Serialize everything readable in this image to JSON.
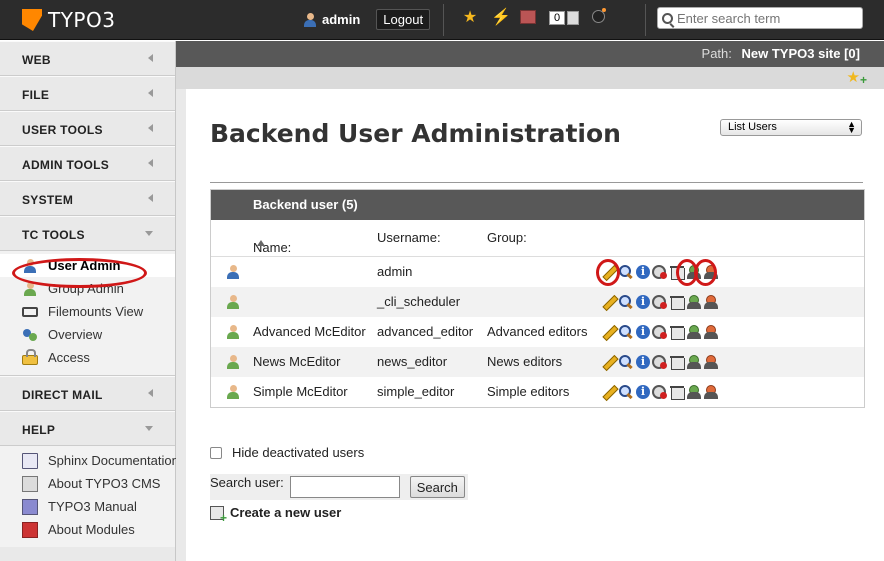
{
  "topbar": {
    "logo_text": "TYPO3",
    "username": "admin",
    "logout_label": "Logout",
    "workspace_counter": "0",
    "search_placeholder": "Enter search term",
    "icons": [
      "bookmark-star-icon",
      "clear-cache-bolt-icon",
      "cache-icon",
      "taskcenter-icon",
      "debug-bomb-icon"
    ]
  },
  "sidebar": {
    "groups": [
      {
        "label": "WEB"
      },
      {
        "label": "FILE"
      },
      {
        "label": "USER TOOLS"
      },
      {
        "label": "ADMIN TOOLS"
      },
      {
        "label": "SYSTEM"
      },
      {
        "label": "TC TOOLS"
      },
      {
        "label": "DIRECT MAIL"
      },
      {
        "label": "HELP"
      }
    ],
    "tc_tools_items": [
      {
        "label": "User Admin",
        "icon": "user-icon",
        "active": true
      },
      {
        "label": "Group Admin",
        "icon": "group-icon"
      },
      {
        "label": "Filemounts View",
        "icon": "filemount-icon"
      },
      {
        "label": "Overview",
        "icon": "overview-icon"
      },
      {
        "label": "Access",
        "icon": "lock-icon"
      }
    ],
    "help_items": [
      {
        "label": "Sphinx Documentation",
        "icon": "doc-icon"
      },
      {
        "label": "About TYPO3 CMS",
        "icon": "about-icon"
      },
      {
        "label": "TYPO3 Manual",
        "icon": "manual-icon"
      },
      {
        "label": "About Modules",
        "icon": "modules-book-icon"
      }
    ]
  },
  "pathbar": {
    "label": "Path:",
    "value": "New TYPO3 site [0]"
  },
  "main": {
    "title": "Backend User Administration",
    "view_select": "List Users",
    "table": {
      "heading": "Backend user (5)",
      "columns": [
        "Name:",
        "Username:",
        "Group:"
      ],
      "rows": [
        {
          "name": "",
          "username": "admin",
          "group": "",
          "admin": true
        },
        {
          "name": "",
          "username": "_cli_scheduler",
          "group": ""
        },
        {
          "name": "Advanced McEditor",
          "username": "advanced_editor",
          "group": "Advanced editors"
        },
        {
          "name": "News McEditor",
          "username": "news_editor",
          "group": "News editors"
        },
        {
          "name": "Simple McEditor",
          "username": "simple_editor",
          "group": "Simple editors"
        }
      ],
      "action_icons": [
        "edit-pencil-icon",
        "view-zoom-icon",
        "info-icon",
        "hide-icon",
        "delete-trash-icon",
        "switch-user-icon",
        "switch-user-back-icon"
      ]
    },
    "hide_deactivated_label": "Hide deactivated users",
    "search_user_label": "Search user:",
    "search_button_label": "Search",
    "create_new_label": "Create a new user"
  },
  "colors": {
    "topbar_bg": "#2c2c2c",
    "pathbar_bg": "#585858",
    "accent_orange": "#ff8700",
    "annotation_red": "#d01818"
  }
}
